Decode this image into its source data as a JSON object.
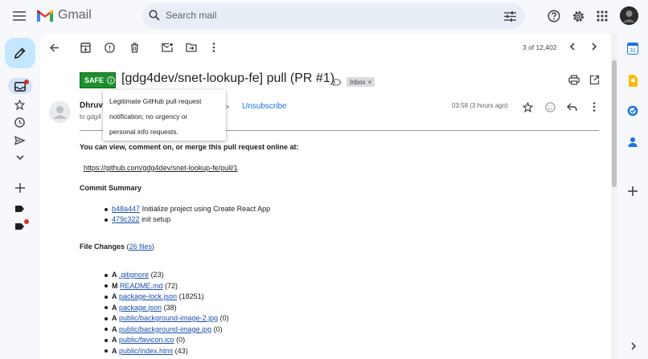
{
  "app": {
    "name": "Gmail"
  },
  "search": {
    "placeholder": "Search mail"
  },
  "toolbar": {
    "pagination": "3 of 12,402"
  },
  "email": {
    "safe_label": "SAFE",
    "subject": "[gdg4dev/snet-lookup-fe] pull (PR #1)",
    "label_chip": "Inbox",
    "tooltip_line1": "Legitimate GitHub pull request",
    "tooltip_line2": "notification; no urgency or",
    "tooltip_line3": "personal info requests.",
    "sender_name": "Dhruv",
    "to_line": "to gdg4",
    "unsubscribe": "Unsubscribe",
    "time": "03:58 (3 hours ago)",
    "body_intro": "You can view, comment on, or merge this pull request online at:",
    "pr_link": "https://github.com/gdg4dev/snet-lookup-fe/pull/1",
    "commit_summary_title": "Commit Summary",
    "commits": [
      {
        "sha": "b48a447",
        "message": "Initialize project using Create React App"
      },
      {
        "sha": "479c322",
        "message": "init setup"
      }
    ],
    "file_changes_title": "File Changes",
    "file_count_link": "26 files",
    "files": [
      {
        "op": "A",
        "name": ".gitignore",
        "count": "(23)"
      },
      {
        "op": "M",
        "name": "README.md",
        "count": "(72)"
      },
      {
        "op": "A",
        "name": "package-lock.json",
        "count": "(18251)"
      },
      {
        "op": "A",
        "name": "package.json",
        "count": "(38)"
      },
      {
        "op": "A",
        "name": "public/background-image-2.jpg",
        "count": "(0)"
      },
      {
        "op": "A",
        "name": "public/background-image.jpg",
        "count": "(0)"
      },
      {
        "op": "A",
        "name": "public/favicon.ico",
        "count": "(0)"
      },
      {
        "op": "A",
        "name": "public/index.html",
        "count": "(43)"
      }
    ]
  },
  "side_panel": {
    "calendar_day": "31"
  },
  "colors": {
    "safe_badge": "#1f8f2e",
    "link": "#1a4fb0",
    "compose": "#c2e7ff"
  }
}
